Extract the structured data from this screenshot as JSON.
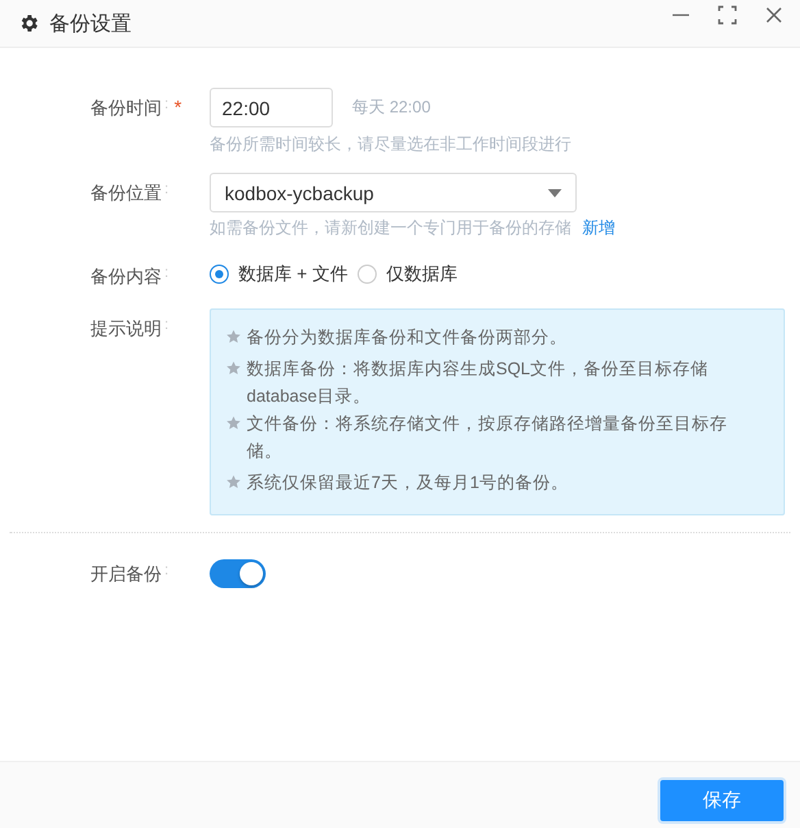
{
  "window": {
    "title": "备份设置"
  },
  "separator": ":",
  "backup_time": {
    "label": "备份时间",
    "required": true,
    "required_mark": "*",
    "value": "22:00",
    "summary": "每天 22:00",
    "hint": "备份所需时间较长，请尽量选在非工作时间段进行"
  },
  "backup_location": {
    "label": "备份位置",
    "value": "kodbox-ycbackup",
    "hint": "如需备份文件，请新创建一个专门用于备份的存储",
    "link": "新增"
  },
  "backup_content": {
    "label": "备份内容",
    "options": [
      {
        "label": "数据库 + 文件",
        "selected": true
      },
      {
        "label": "仅数据库",
        "selected": false
      }
    ]
  },
  "notes": {
    "label": "提示说明",
    "items": [
      "备份分为数据库备份和文件备份两部分。",
      "数据库备份：将数据库内容生成SQL文件，备份至目标存储database目录。",
      "文件备份：将系统存储文件，按原存储路径增量备份至目标存储。",
      "系统仅保留最近7天，及每月1号的备份。"
    ]
  },
  "enable_backup": {
    "label": "开启备份",
    "on": true
  },
  "buttons": [
    {
      "label": "保存"
    }
  ]
}
